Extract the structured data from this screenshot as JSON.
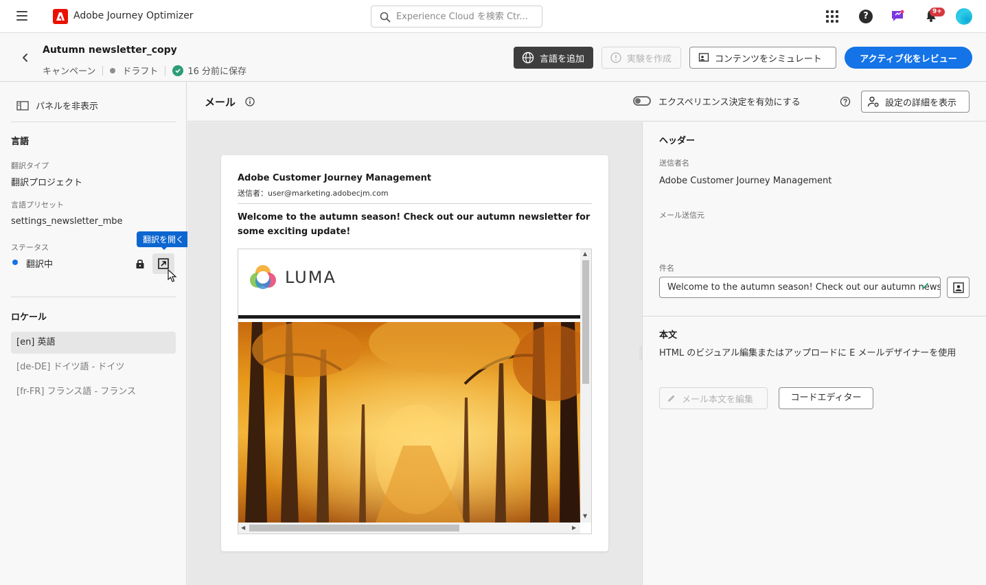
{
  "topbar": {
    "app_name": "Adobe Journey Optimizer",
    "search_placeholder": "Experience Cloud を検索 Ctr...",
    "notification_count": "9+"
  },
  "header": {
    "campaign_title": "Autumn newsletter_copy",
    "type": "キャンペーン",
    "status": "ドラフト",
    "saved": "16 分前に保存",
    "add_language": "言語を追加",
    "create_experiment": "実験を作成",
    "simulate_content": "コンテンツをシミュレート",
    "review_activate": "アクティブ化をレビュー"
  },
  "left_panel": {
    "hide_panel": "パネルを非表示",
    "language_section": "言語",
    "translation_type_label": "翻訳タイプ",
    "translation_type_value": "翻訳プロジェクト",
    "language_preset_label": "言語プリセット",
    "language_preset_value": "settings_newsletter_mbe",
    "status_label": "ステータス",
    "status_value": "翻訳中",
    "tooltip": "翻訳を開く",
    "locale_section": "ロケール",
    "locales": [
      {
        "label": "[en] 英語",
        "active": true
      },
      {
        "label": "[de-DE] ドイツ語 - ドイツ",
        "active": false
      },
      {
        "label": "[fr-FR] フランス語 - フランス",
        "active": false
      }
    ]
  },
  "center": {
    "title": "メール",
    "experience_toggle": "エクスペリエンス決定を有効にする",
    "settings_button": "設定の詳細を表示",
    "preview": {
      "sender_name": "Adobe Customer Journey Management",
      "from": "送信者：user@marketing.adobecjm.com",
      "subject": "Welcome to the autumn season! Check out our autumn newsletter for some exciting update!",
      "logo_text": "LUMA"
    }
  },
  "right_panel": {
    "header_section": "ヘッダー",
    "sender_name_label": "送信者名",
    "sender_name_value": "Adobe Customer Journey Management",
    "email_from_label": "メール送信元",
    "subject_label": "件名",
    "subject_value": "Welcome to the autumn season! Check out our autumn news...",
    "body_section": "本文",
    "body_desc": "HTML のビジュアル編集またはアップロードに E メールデザイナーを使用",
    "edit_body": "メール本文を編集",
    "code_editor": "コードエディター"
  },
  "colors": {
    "accent": "#1473e6",
    "adobe_red": "#eb1000",
    "success": "#2d9d78"
  }
}
